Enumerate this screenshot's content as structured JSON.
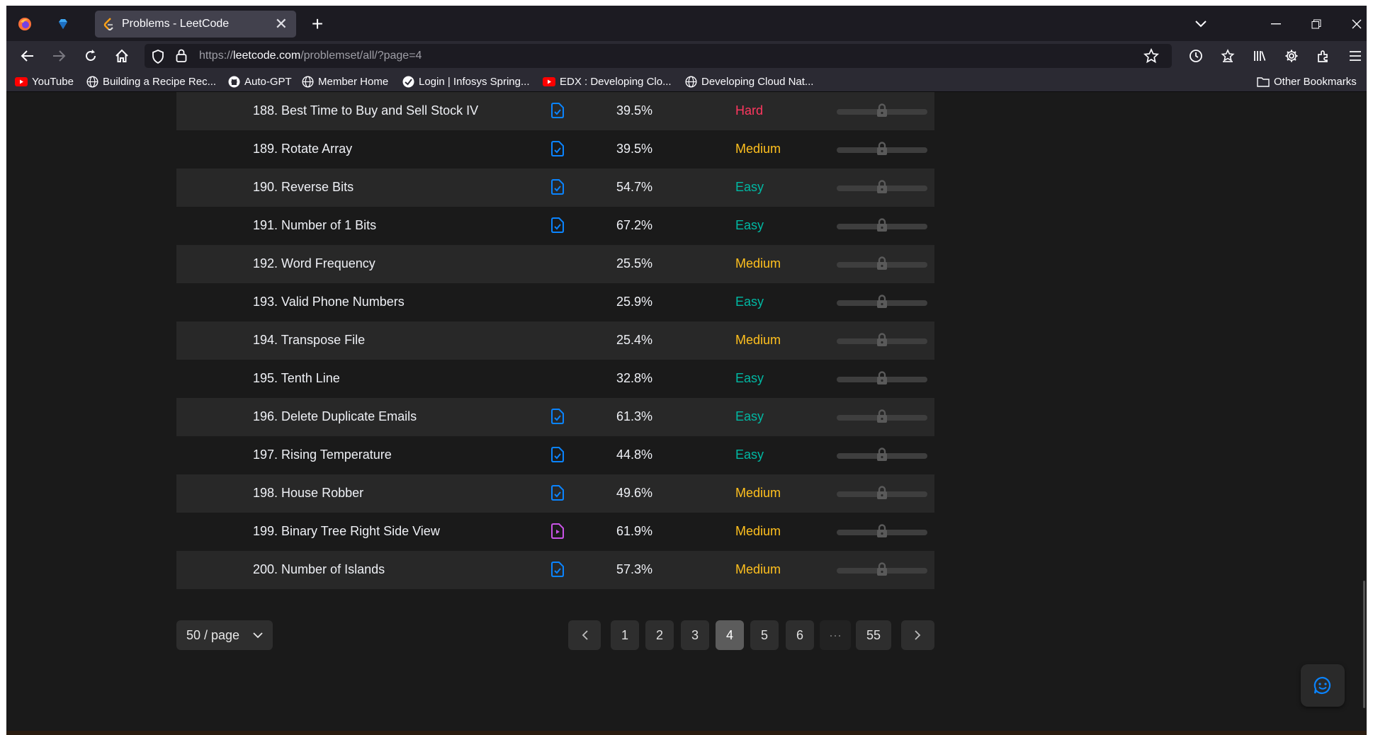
{
  "browser": {
    "tab_title": "Problems - LeetCode",
    "url_prefix": "https://",
    "url_domain": "leetcode.com",
    "url_path": "/problemset/all/?page=4"
  },
  "bookmarks": [
    {
      "label": "YouTube",
      "icon": "youtube-icon"
    },
    {
      "label": "Building a Recipe Rec...",
      "icon": "globe-icon"
    },
    {
      "label": "Auto-GPT",
      "icon": "github-icon"
    },
    {
      "label": "Member Home",
      "icon": "globe-icon"
    },
    {
      "label": "Login | Infosys Spring...",
      "icon": "infosys-icon"
    },
    {
      "label": "EDX : Developing Clo...",
      "icon": "youtube-icon"
    },
    {
      "label": "Developing Cloud Nat...",
      "icon": "globe-icon"
    }
  ],
  "other_bookmarks": "Other Bookmarks",
  "problems": [
    {
      "title": "188. Best Time to Buy and Sell Stock IV",
      "solution": "article",
      "acceptance": "39.5%",
      "difficulty": "Hard"
    },
    {
      "title": "189. Rotate Array",
      "solution": "article",
      "acceptance": "39.5%",
      "difficulty": "Medium"
    },
    {
      "title": "190. Reverse Bits",
      "solution": "article",
      "acceptance": "54.7%",
      "difficulty": "Easy"
    },
    {
      "title": "191. Number of 1 Bits",
      "solution": "article",
      "acceptance": "67.2%",
      "difficulty": "Easy"
    },
    {
      "title": "192. Word Frequency",
      "solution": "",
      "acceptance": "25.5%",
      "difficulty": "Medium"
    },
    {
      "title": "193. Valid Phone Numbers",
      "solution": "",
      "acceptance": "25.9%",
      "difficulty": "Easy"
    },
    {
      "title": "194. Transpose File",
      "solution": "",
      "acceptance": "25.4%",
      "difficulty": "Medium"
    },
    {
      "title": "195. Tenth Line",
      "solution": "",
      "acceptance": "32.8%",
      "difficulty": "Easy"
    },
    {
      "title": "196. Delete Duplicate Emails",
      "solution": "article",
      "acceptance": "61.3%",
      "difficulty": "Easy"
    },
    {
      "title": "197. Rising Temperature",
      "solution": "article",
      "acceptance": "44.8%",
      "difficulty": "Easy"
    },
    {
      "title": "198. House Robber",
      "solution": "article",
      "acceptance": "49.6%",
      "difficulty": "Medium"
    },
    {
      "title": "199. Binary Tree Right Side View",
      "solution": "video",
      "acceptance": "61.9%",
      "difficulty": "Medium"
    },
    {
      "title": "200. Number of Islands",
      "solution": "article",
      "acceptance": "57.3%",
      "difficulty": "Medium"
    }
  ],
  "difficulty_colors": {
    "Easy": "#00b8a3",
    "Medium": "#ffc01e",
    "Hard": "#ff375f"
  },
  "solution_colors": {
    "article": "#0a84ff",
    "video": "#c953e6"
  },
  "pagination": {
    "page_size_label": "50 / page",
    "pages": [
      "1",
      "2",
      "3",
      "4",
      "5",
      "6",
      "···",
      "55"
    ],
    "current": "4"
  }
}
